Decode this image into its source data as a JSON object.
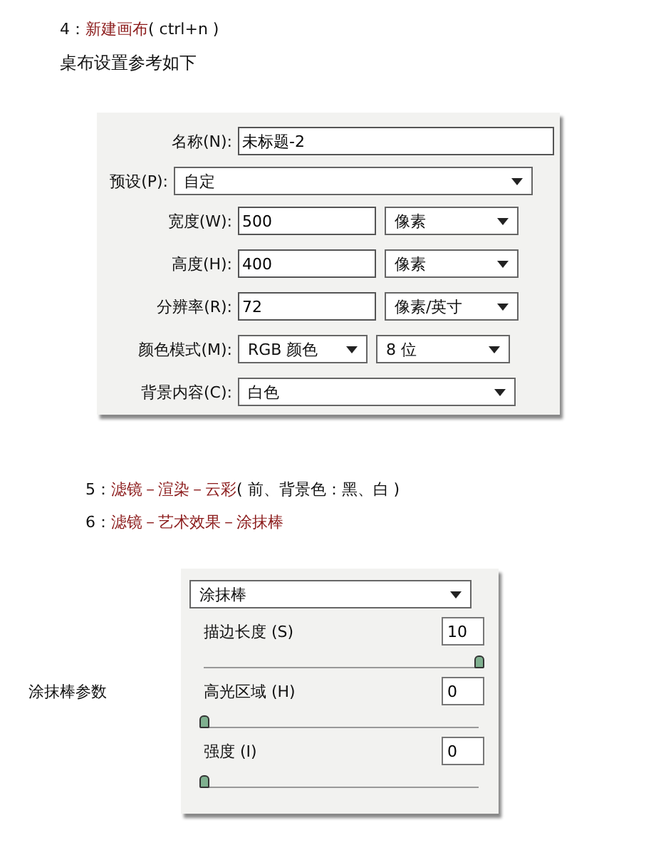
{
  "step4": {
    "parts": [
      {
        "text": "4：",
        "kind": "plain"
      },
      {
        "text": "新建画布",
        "kind": "accent"
      },
      {
        "text": "( ctrl+n )",
        "kind": "plain"
      }
    ]
  },
  "step4_note": "桌布设置参考如下",
  "new_dialog": {
    "name": {
      "label": "名称(N):",
      "value": "未标题-2"
    },
    "preset": {
      "label": "预设(P):",
      "value": "自定"
    },
    "rows": [
      {
        "kind": "field",
        "label": "宽度(W):",
        "value": "500",
        "unit": "像素"
      },
      {
        "kind": "field",
        "label": "高度(H):",
        "value": "400",
        "unit": "像素"
      },
      {
        "kind": "field",
        "label": "分辨率(R):",
        "value": "72",
        "unit": "像素/英寸"
      },
      {
        "kind": "select",
        "label": "颜色模式(M):",
        "value": "RGB 颜色",
        "unit": "8 位"
      },
      {
        "kind": "wide",
        "label": "背景内容(C):",
        "value": "白色"
      }
    ]
  },
  "step5": {
    "parts": [
      {
        "text": "5：",
        "kind": "plain"
      },
      {
        "text": "滤镜－渲染－云彩",
        "kind": "accent"
      },
      {
        "text": "( 前、背景色：黑、白 )",
        "kind": "plain"
      }
    ]
  },
  "step6": {
    "parts": [
      {
        "text": "6：",
        "kind": "plain"
      },
      {
        "text": "滤镜－艺术效果－涂抹棒",
        "kind": "accent"
      }
    ]
  },
  "smudge_caption": "涂抹棒参数",
  "smudge_panel": {
    "filter": "涂抹棒",
    "sliders": [
      {
        "label": "描边长度 (S)",
        "value": "10",
        "level": 1
      },
      {
        "label": "高光区域 (H)",
        "value": "0",
        "level": 0
      },
      {
        "label": "强度 (I)",
        "value": "0",
        "level": 0
      }
    ]
  }
}
